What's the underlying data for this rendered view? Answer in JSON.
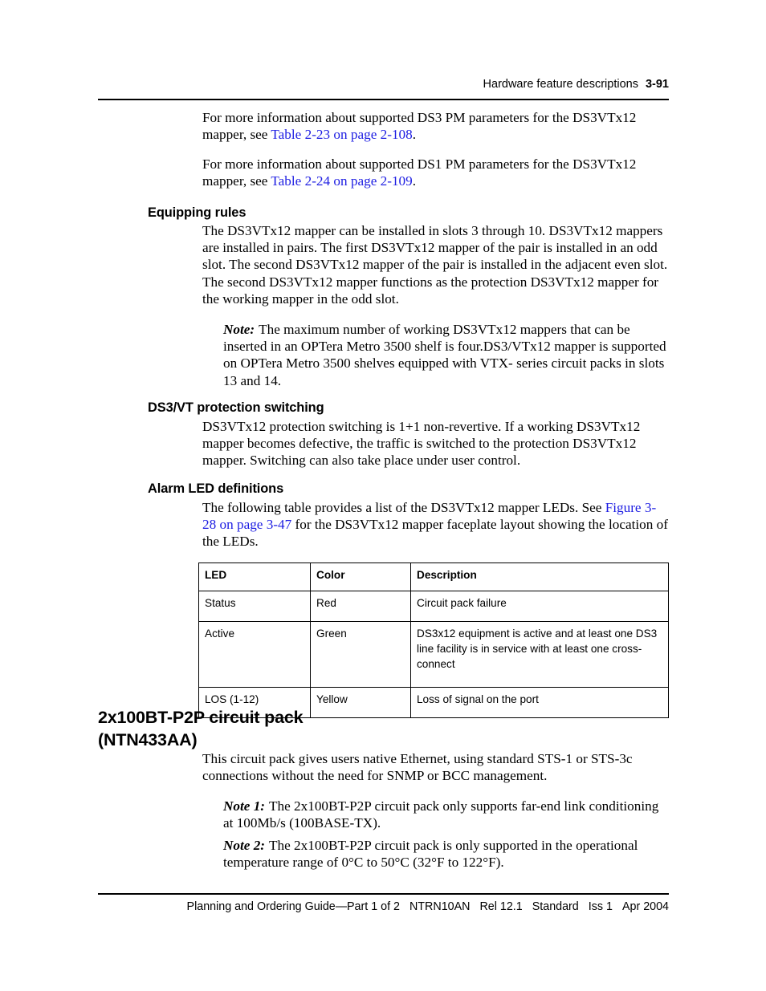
{
  "header": {
    "running_title": "Hardware feature descriptions",
    "page_number": "3-91"
  },
  "intro": {
    "para1_before": "For more information about supported DS3 PM parameters for the DS3VTx12 mapper, see ",
    "para1_link": "Table 2-23 on page 2-108",
    "para1_after": ".",
    "para2_before": "For more information about supported DS1 PM parameters for the DS3VTx12 mapper, see ",
    "para2_link": "Table 2-24 on page 2-109",
    "para2_after": "."
  },
  "equipping": {
    "heading": "Equipping rules",
    "body": "The DS3VTx12 mapper can be installed in slots 3 through 10. DS3VTx12 mappers are installed in pairs. The first DS3VTx12 mapper of the pair is installed in an odd slot. The second DS3VTx12 mapper of the pair is installed in the adjacent even slot. The second DS3VTx12 mapper functions as the protection DS3VTx12 mapper for the working mapper in the odd slot.",
    "note_label": "Note:",
    "note_body": "The maximum number of working DS3VTx12 mappers that can be inserted in an OPTera Metro 3500 shelf is four.DS3/VTx12 mapper is supported on OPTera Metro 3500 shelves equipped with VTX- series circuit packs in slots 13 and 14."
  },
  "protection": {
    "heading": "DS3/VT protection switching",
    "body": "DS3VTx12 protection switching is 1+1 non-revertive. If a working DS3VTx12 mapper becomes defective, the traffic is switched to the protection DS3VTx12 mapper. Switching can also take place under user control."
  },
  "alarm": {
    "heading": "Alarm LED definitions",
    "body_before": "The following table provides a list of the DS3VTx12 mapper LEDs. See ",
    "body_link": "Figure 3-28 on page 3-47",
    "body_after": " for the DS3VTx12 mapper faceplate layout showing the location of the LEDs."
  },
  "led_table": {
    "columns": [
      "LED",
      "Color",
      "Description"
    ],
    "rows": [
      [
        "Status",
        "Red",
        "Circuit pack failure"
      ],
      [
        "Active",
        "Green",
        "DS3x12 equipment is active and at least one DS3 line facility is in service with at least one cross-connect"
      ],
      [
        "LOS (1-12)",
        "Yellow",
        "Loss of signal on the port"
      ]
    ]
  },
  "circuit_pack": {
    "heading_line1": "2x100BT-P2P circuit pack",
    "heading_line2": "(NTN433AA)",
    "body": " This circuit pack gives users native Ethernet, using standard STS-1 or STS-3c connections without the need for SNMP or BCC management.",
    "note1_label": "Note 1:",
    "note1_body": "The 2x100BT-P2P circuit pack only supports far-end link conditioning at 100Mb/s (100BASE-TX).",
    "note2_label": "Note 2:",
    "note2_body": "The 2x100BT-P2P circuit pack is only supported in the operational temperature range of 0°C to 50°C (32°F to 122°F)."
  },
  "footer": {
    "guide": "Planning and Ordering Guide—Part 1 of 2",
    "doc_number": "NTRN10AN",
    "release": "Rel 12.1",
    "status": "Standard",
    "issue": "Iss 1",
    "date": "Apr 2004"
  },
  "colors": {
    "link": "#1d1de2",
    "text": "#000000",
    "background": "#ffffff"
  }
}
